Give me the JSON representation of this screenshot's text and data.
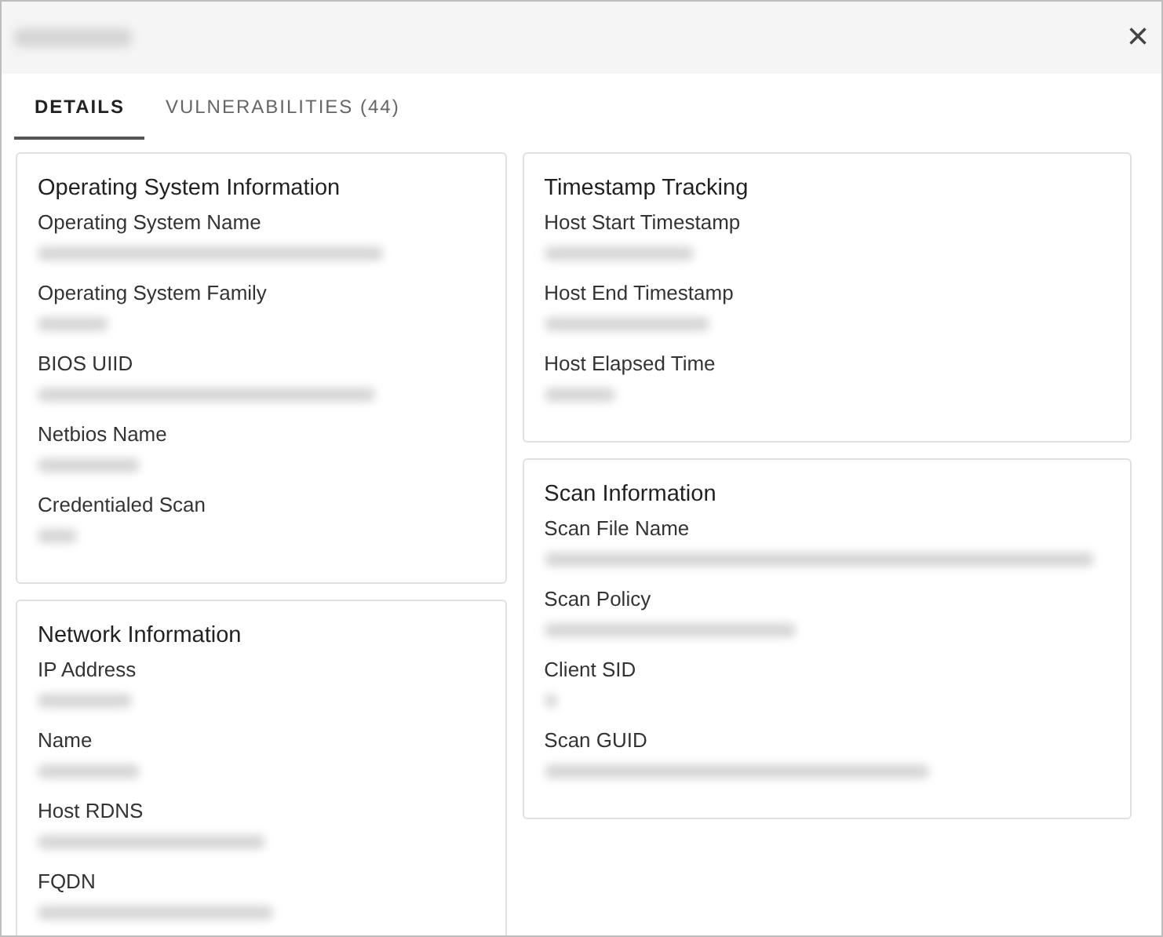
{
  "dialog": {
    "title_redacted": true,
    "close": "×"
  },
  "tabs": [
    {
      "label": "DETAILS",
      "selected": true
    },
    {
      "label": "VULNERABILITIES (44)",
      "selected": false
    }
  ],
  "columns": [
    {
      "sections": [
        {
          "title": "Operating System Information",
          "fields": [
            {
              "label": "Operating System Name",
              "redacted": true
            },
            {
              "label": "Operating System Family",
              "redacted": true
            },
            {
              "label": "BIOS UIID",
              "redacted": true
            },
            {
              "label": "Netbios Name",
              "redacted": true
            },
            {
              "label": "Credentialed Scan",
              "redacted": true
            }
          ]
        },
        {
          "title": "Network Information",
          "fields": [
            {
              "label": "IP Address",
              "redacted": true
            },
            {
              "label": "Name",
              "redacted": true
            },
            {
              "label": "Host RDNS",
              "redacted": true
            },
            {
              "label": "FQDN",
              "redacted": true
            }
          ]
        }
      ]
    },
    {
      "sections": [
        {
          "title": "Timestamp Tracking",
          "fields": [
            {
              "label": "Host Start Timestamp",
              "redacted": true
            },
            {
              "label": "Host End Timestamp",
              "redacted": true
            },
            {
              "label": "Host Elapsed Time",
              "redacted": true
            }
          ]
        },
        {
          "title": "Scan Information",
          "fields": [
            {
              "label": "Scan File Name",
              "redacted": true
            },
            {
              "label": "Scan Policy",
              "redacted": true
            },
            {
              "label": "Client SID",
              "redacted": true
            },
            {
              "label": "Scan GUID",
              "redacted": true
            }
          ]
        }
      ]
    }
  ]
}
